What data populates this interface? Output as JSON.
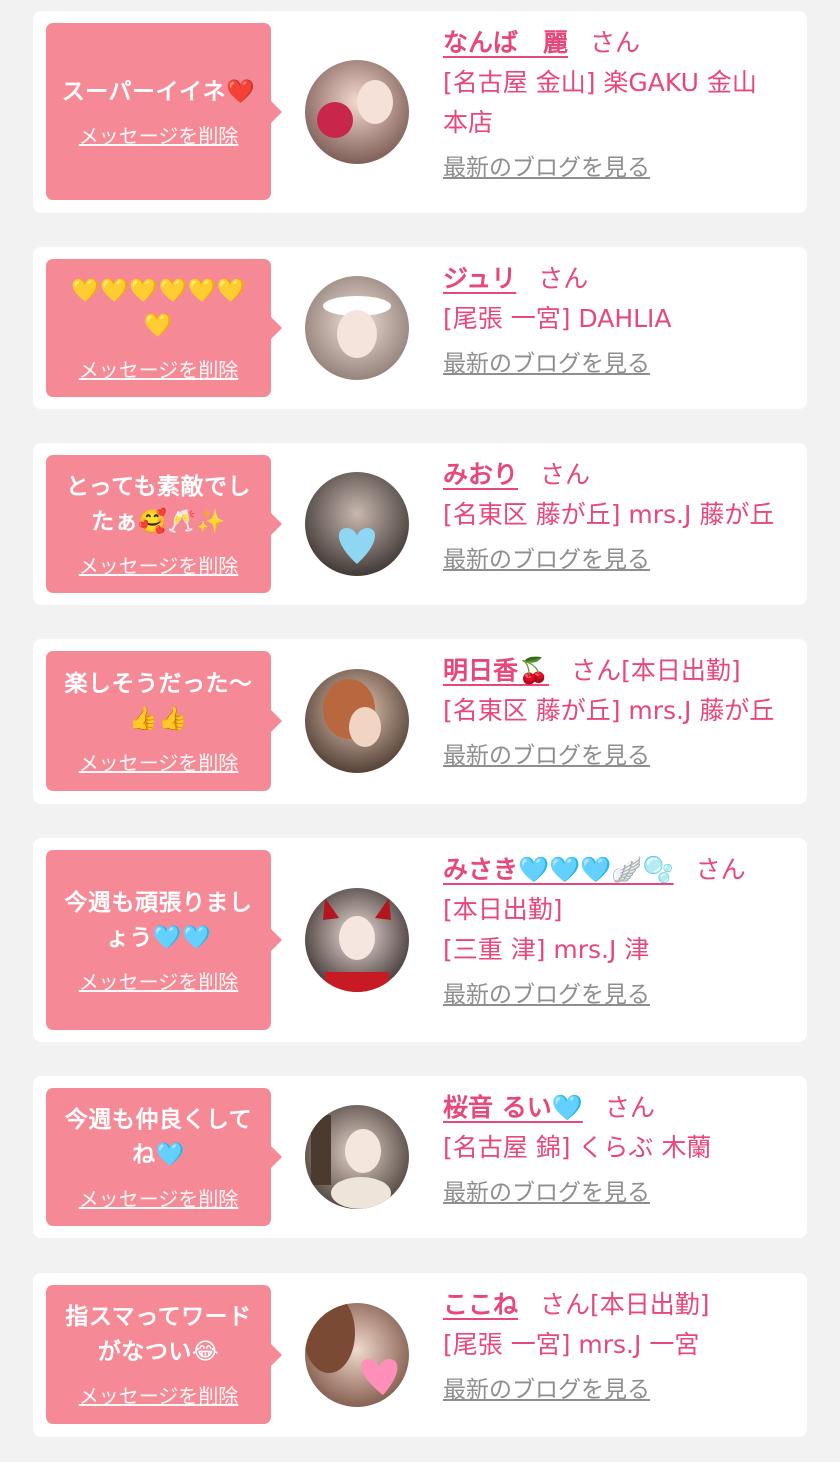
{
  "colors": {
    "accent": "#e8477a",
    "bubble": "#f58a96",
    "background": "#f2f2f2",
    "link_gray": "#8e8e8e"
  },
  "delete_label": "メッセージを削除",
  "blog_label": "最新のブログを見る",
  "items": [
    {
      "message": "スーパーイイネ❤️",
      "name": "なんば　麗",
      "san": "さん",
      "details": [
        "[名古屋 金山] 楽GAKU 金山",
        "本店"
      ]
    },
    {
      "message": "💛💛💛💛💛💛💛",
      "name": "ジュリ",
      "san": "さん",
      "details": [
        "[尾張 一宮] DAHLIA"
      ]
    },
    {
      "message": "とっても素敵でしたぁ🥰🥂✨",
      "name": "みおり",
      "san": "さん",
      "details": [
        "[名東区 藤が丘] mrs.J 藤が丘"
      ]
    },
    {
      "message": "楽しそうだった〜👍👍",
      "name": "明日香🍒",
      "san": "さん[本日出勤]",
      "details": [
        "[名東区 藤が丘] mrs.J 藤が丘"
      ]
    },
    {
      "message": "今週も頑張りましょう🩵🩵",
      "name": "みさき🩵🩵🩵🪽🫧",
      "san": "さん",
      "details": [
        "[本日出勤]",
        "[三重 津] mrs.J 津"
      ]
    },
    {
      "message": "今週も仲良くしてね🩵",
      "name": "桜音 るい🩵",
      "san": "さん",
      "details": [
        "[名古屋 錦] くらぶ 木蘭"
      ]
    },
    {
      "message": "指スマってワードがなつい😂",
      "name": "ここね",
      "san": "さん[本日出勤]",
      "details": [
        "[尾張 一宮] mrs.J 一宮"
      ]
    }
  ]
}
